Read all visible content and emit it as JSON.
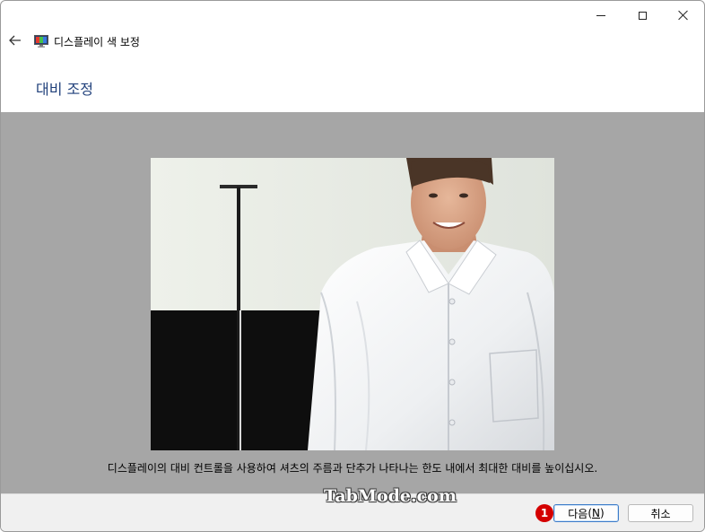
{
  "window": {
    "controls": {
      "minimize": "minimize-icon",
      "maximize": "maximize-icon",
      "close": "close-icon"
    }
  },
  "nav": {
    "back_icon": "back-arrow-icon",
    "app_icon": "display-monitor-icon",
    "app_title": "디스플레이 색 보정"
  },
  "page": {
    "heading": "대비 조정",
    "instruction": "디스플레이의 대비 컨트롤을 사용하여 셔츠의 주름과 단추가 나타나는 한도 내에서 최대한 대비를 높이십시오."
  },
  "footer": {
    "watermark": "TabMode.com",
    "step_badge": "1",
    "next_label": "다음",
    "next_accel": "N",
    "cancel_label": "취소"
  },
  "colors": {
    "heading": "#1f3f7a",
    "content_bg": "#a6a6a6",
    "badge": "#d40000",
    "button_focus": "#3d7cc9"
  }
}
